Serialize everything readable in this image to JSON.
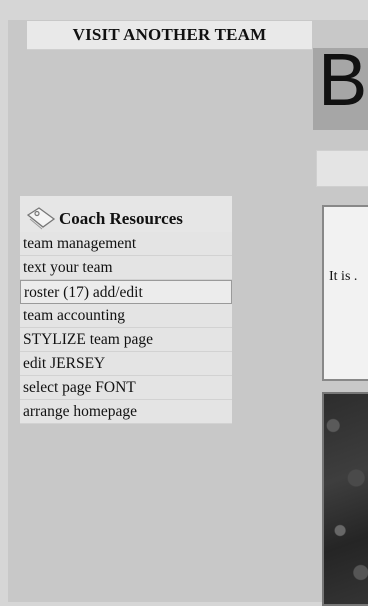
{
  "visit_button": {
    "label": "VISIT ANOTHER TEAM"
  },
  "header": {
    "title_fragment": "B"
  },
  "content": {
    "text_fragment": "It is ."
  },
  "coach_resources": {
    "title": "Coach Resources",
    "icon": "tag-icon",
    "items": [
      {
        "label": "team management"
      },
      {
        "label": "text your team"
      },
      {
        "label": "roster (17) add/edit"
      },
      {
        "label": "team accounting"
      },
      {
        "label": "STYLIZE team page"
      },
      {
        "label": "edit JERSEY"
      },
      {
        "label": "select page FONT"
      },
      {
        "label": "arrange homepage"
      }
    ]
  }
}
